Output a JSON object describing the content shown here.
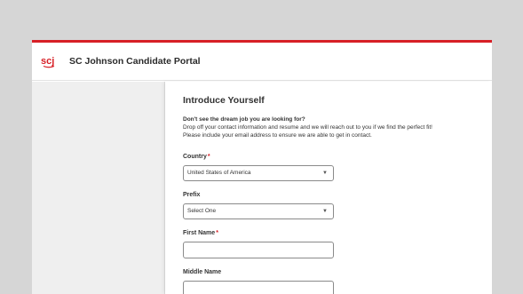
{
  "header": {
    "logo_text": "scj",
    "title": "SC Johnson Candidate Portal"
  },
  "form": {
    "title": "Introduce Yourself",
    "intro_heading": "Don't see the dream job you are looking for?",
    "intro_line1": "Drop off your contact information and resume and we will reach out to you if we find the perfect fit!",
    "intro_line2": "Please include your email address to ensure we are able to get in contact.",
    "required_marker": "*",
    "fields": {
      "country": {
        "label": "Country",
        "value": "United States of America"
      },
      "prefix": {
        "label": "Prefix",
        "value": "Select One"
      },
      "first_name": {
        "label": "First Name",
        "value": ""
      },
      "middle_name": {
        "label": "Middle Name",
        "value": ""
      }
    }
  },
  "icons": {
    "logo": "scj-logo-icon",
    "dropdown": "chevron-down-icon"
  },
  "colors": {
    "accent": "#d71f26",
    "background": "#d6d6d6",
    "sidebar": "#efefef"
  }
}
